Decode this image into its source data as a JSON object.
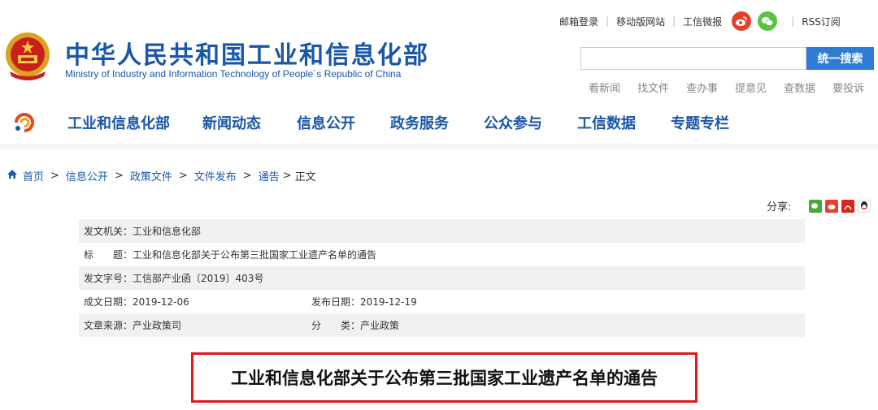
{
  "header": {
    "title_cn": "中华人民共和国工业和信息化部",
    "title_en": "Ministry of Industry and Information Technology of People´s Republic of China",
    "top_links": [
      "邮箱登录",
      "移动版网站",
      "工信微报"
    ],
    "rss": "RSS订阅",
    "search_placeholder": "",
    "search_button": "统一搜索",
    "quick_links": [
      "看新闻",
      "找文件",
      "查办事",
      "提意见",
      "查数据",
      "要投诉"
    ]
  },
  "nav": {
    "items": [
      "工业和信息化部",
      "新闻动态",
      "信息公开",
      "政务服务",
      "公众参与",
      "工信数据",
      "专题专栏"
    ]
  },
  "breadcrumb": [
    "首页",
    "信息公开",
    "政策文件",
    "文件发布",
    "通告",
    "正文"
  ],
  "share": {
    "label": "分享:"
  },
  "meta": {
    "issuer": "发文机关：工业和信息化部",
    "title": "标　　题：工业和信息化部关于公布第三批国家工业遗产名单的通告",
    "doc_no": "发文字号：工信部产业函〔2019〕403号",
    "written_date": "成文日期：2019-12-06",
    "publish_date": "发布日期：2019-12-19",
    "source": "文章来源：产业政策司",
    "category": "分　　类：产业政策"
  },
  "article": {
    "headline": "工业和信息化部关于公布第三批国家工业遗产名单的通告"
  },
  "colors": {
    "brand_blue": "#1a57a8",
    "search_blue": "#2f7bd6",
    "highlight_red": "#e0191c"
  }
}
